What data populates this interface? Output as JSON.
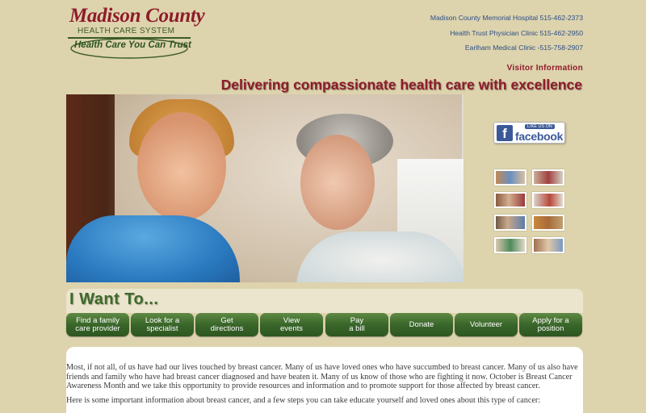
{
  "logo": {
    "line1": "Madison County",
    "line2": "HEALTH CARE SYSTEM",
    "line3": "Health Care You Can Trust"
  },
  "contacts": [
    "Madison County Memorial Hospital  515-462-2373",
    "Health Trust Physician Clinic  515-462-2950",
    "Earlham Medical Clinic -515-758-2907"
  ],
  "visitor_link": "Visitor Information",
  "tagline": "Delivering compassionate health care with excellence",
  "facebook": {
    "small": "LIKE US ON",
    "word": "facebook"
  },
  "iwant": {
    "title": "I Want To...",
    "buttons": [
      "Find a family\ncare provider",
      "Look for a\nspecialist",
      "Get\ndirections",
      "View\nevents",
      "Pay\na bill",
      "Donate",
      "Volunteer",
      "Apply for a\nposition"
    ]
  },
  "content": {
    "p1": "Most, if not all, of us have had our lives touched by breast cancer. Many of us have loved ones who have succumbed to breast cancer. Many of us also have friends and family who have had breast cancer diagnosed and have beaten it. Many of us know of those who are fighting it now. October is Breast Cancer Awareness Month and we take this opportunity to provide resources and information and to promote support for those affected by breast cancer.",
    "p2": "Here is some important information about breast cancer, and a few steps you can take educate yourself and loved ones about this type of cancer:"
  },
  "colors": {
    "background": "#ddd3ad",
    "maroon": "#8e1b2a",
    "green": "#39662a",
    "link_blue": "#2d4e86"
  }
}
